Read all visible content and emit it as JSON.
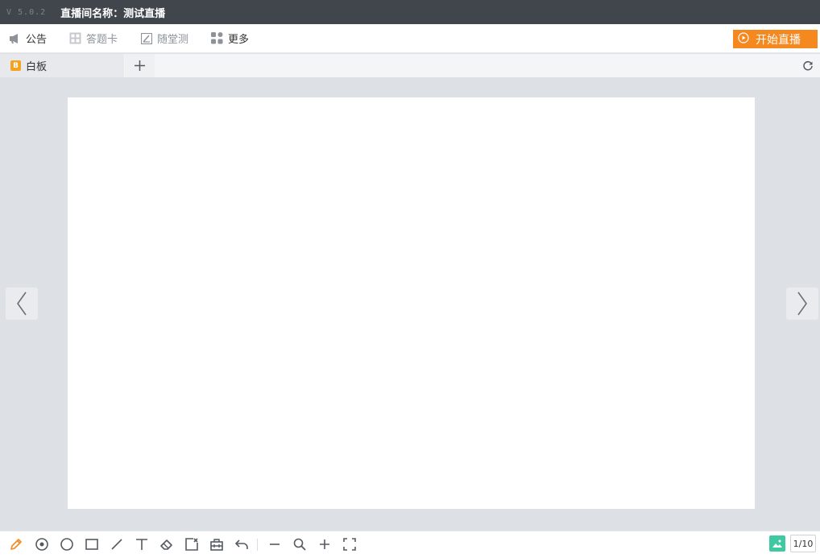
{
  "titlebar": {
    "version": "V 5.0.2",
    "room_name": "直播间名称：测试直播"
  },
  "toolbar": {
    "items": [
      {
        "label": "公告",
        "icon": "megaphone-icon",
        "enabled": true
      },
      {
        "label": "答题卡",
        "icon": "answer-card-icon",
        "enabled": false
      },
      {
        "label": "随堂测",
        "icon": "quiz-icon",
        "enabled": false
      },
      {
        "label": "更多",
        "icon": "grid-icon",
        "enabled": true
      }
    ],
    "start_live_label": "开始直播",
    "accent": "#f5891f"
  },
  "tabs": {
    "active_label": "白板",
    "badge": "B",
    "add_label": "+"
  },
  "bottom": {
    "tools": [
      "pencil-icon",
      "laser-pointer-icon",
      "circle-icon",
      "rectangle-icon",
      "line-icon",
      "text-icon",
      "eraser-icon",
      "clear-icon",
      "toolbox-icon",
      "undo-icon",
      "zoom-out-icon",
      "zoom-icon",
      "zoom-in-icon",
      "fullscreen-icon"
    ],
    "active_tool_color": "#f5891f",
    "page": "1/10"
  }
}
